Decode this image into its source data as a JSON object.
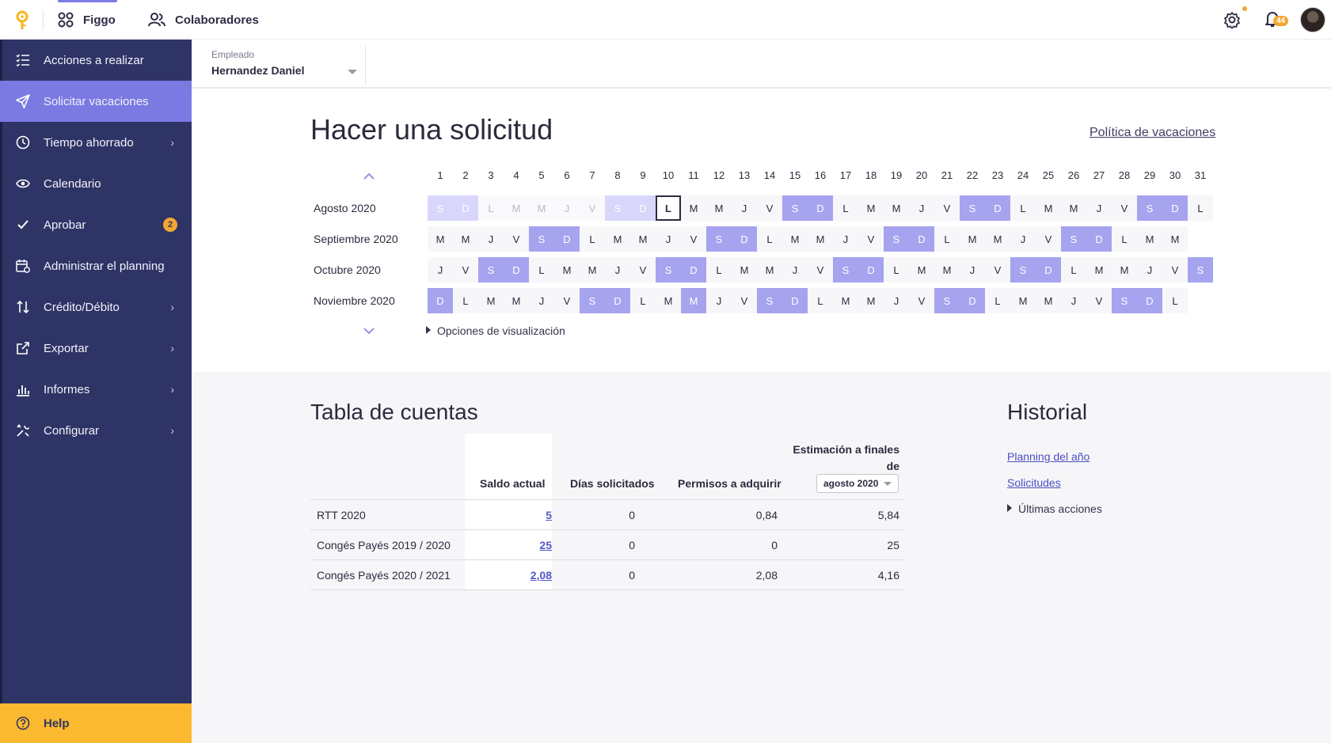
{
  "topbar": {
    "app_name": "Figgo",
    "collaborators": "Colaboradores",
    "notifications_count": "44"
  },
  "sidebar": {
    "items": [
      {
        "label": "Acciones a realizar",
        "icon": "list-check-icon"
      },
      {
        "label": "Solicitar vacaciones",
        "icon": "send-icon",
        "active": true
      },
      {
        "label": "Tiempo ahorrado",
        "icon": "clock-icon",
        "chevron": true
      },
      {
        "label": "Calendario",
        "icon": "eye-icon"
      },
      {
        "label": "Aprobar",
        "icon": "check-icon",
        "badge": "2"
      },
      {
        "label": "Administrar el planning",
        "icon": "calendar-gear-icon"
      },
      {
        "label": "Crédito/Débito",
        "icon": "up-down-arrows-icon",
        "chevron": true
      },
      {
        "label": "Exportar",
        "icon": "external-link-icon",
        "chevron": true
      },
      {
        "label": "Informes",
        "icon": "bar-chart-icon",
        "chevron": true
      },
      {
        "label": "Configurar",
        "icon": "tools-icon",
        "chevron": true
      }
    ],
    "help_label": "Help"
  },
  "employee": {
    "label": "Empleado",
    "value": "Hernandez Daniel"
  },
  "request": {
    "title": "Hacer una solicitud",
    "policy_link": "Política de vacaciones",
    "options_label": "Opciones de visualización",
    "day_numbers": [
      "1",
      "2",
      "3",
      "4",
      "5",
      "6",
      "7",
      "8",
      "9",
      "10",
      "11",
      "12",
      "13",
      "14",
      "15",
      "16",
      "17",
      "18",
      "19",
      "20",
      "21",
      "22",
      "23",
      "24",
      "25",
      "26",
      "27",
      "28",
      "29",
      "30",
      "31"
    ],
    "months": [
      {
        "name": "Agosto 2020",
        "days": [
          "S",
          "D",
          "L",
          "M",
          "M",
          "J",
          "V",
          "S",
          "D",
          "L",
          "M",
          "M",
          "J",
          "V",
          "S",
          "D",
          "L",
          "M",
          "M",
          "J",
          "V",
          "S",
          "D",
          "L",
          "M",
          "M",
          "J",
          "V",
          "S",
          "D",
          "L"
        ],
        "past_until": 9,
        "today": 10
      },
      {
        "name": "Septiembre 2020",
        "days": [
          "M",
          "M",
          "J",
          "V",
          "S",
          "D",
          "L",
          "M",
          "M",
          "J",
          "V",
          "S",
          "D",
          "L",
          "M",
          "M",
          "J",
          "V",
          "S",
          "D",
          "L",
          "M",
          "M",
          "J",
          "V",
          "S",
          "D",
          "L",
          "M",
          "M"
        ]
      },
      {
        "name": "Octubre 2020",
        "days": [
          "J",
          "V",
          "S",
          "D",
          "L",
          "M",
          "M",
          "J",
          "V",
          "S",
          "D",
          "L",
          "M",
          "M",
          "J",
          "V",
          "S",
          "D",
          "L",
          "M",
          "M",
          "J",
          "V",
          "S",
          "D",
          "L",
          "M",
          "M",
          "J",
          "V",
          "S"
        ]
      },
      {
        "name": "Noviembre 2020",
        "days": [
          "D",
          "L",
          "M",
          "M",
          "J",
          "V",
          "S",
          "D",
          "L",
          "M",
          "M",
          "J",
          "V",
          "S",
          "D",
          "L",
          "M",
          "M",
          "J",
          "V",
          "S",
          "D",
          "L",
          "M",
          "M",
          "J",
          "V",
          "S",
          "D",
          "L"
        ],
        "holidays": [
          1,
          11
        ]
      }
    ]
  },
  "accounts": {
    "title": "Tabla de cuentas",
    "headers": {
      "balance": "Saldo actual",
      "requested": "Días solicitados",
      "to_acquire": "Permisos a adquirir",
      "estimate_line1": "Estimación a finales",
      "estimate_line2": "de",
      "estimate_select": "agosto 2020"
    },
    "rows": [
      {
        "name": "RTT 2020",
        "balance": "5",
        "requested": "0",
        "to_acquire": "0,84",
        "estimate": "5,84"
      },
      {
        "name": "Congés Payés 2019 / 2020",
        "balance": "25",
        "requested": "0",
        "to_acquire": "0",
        "estimate": "25"
      },
      {
        "name": "Congés Payés 2020 / 2021",
        "balance": "2,08",
        "requested": "0",
        "to_acquire": "2,08",
        "estimate": "4,16"
      }
    ]
  },
  "history": {
    "title": "Historial",
    "links": [
      "Planning del año",
      "Solicitudes"
    ],
    "last_actions": "Últimas acciones"
  },
  "colors": {
    "sidebar_bg": "#2f3466",
    "accent": "#7b79e2",
    "weekend": "#a6a3ef",
    "help_bg": "#fbb92f"
  }
}
